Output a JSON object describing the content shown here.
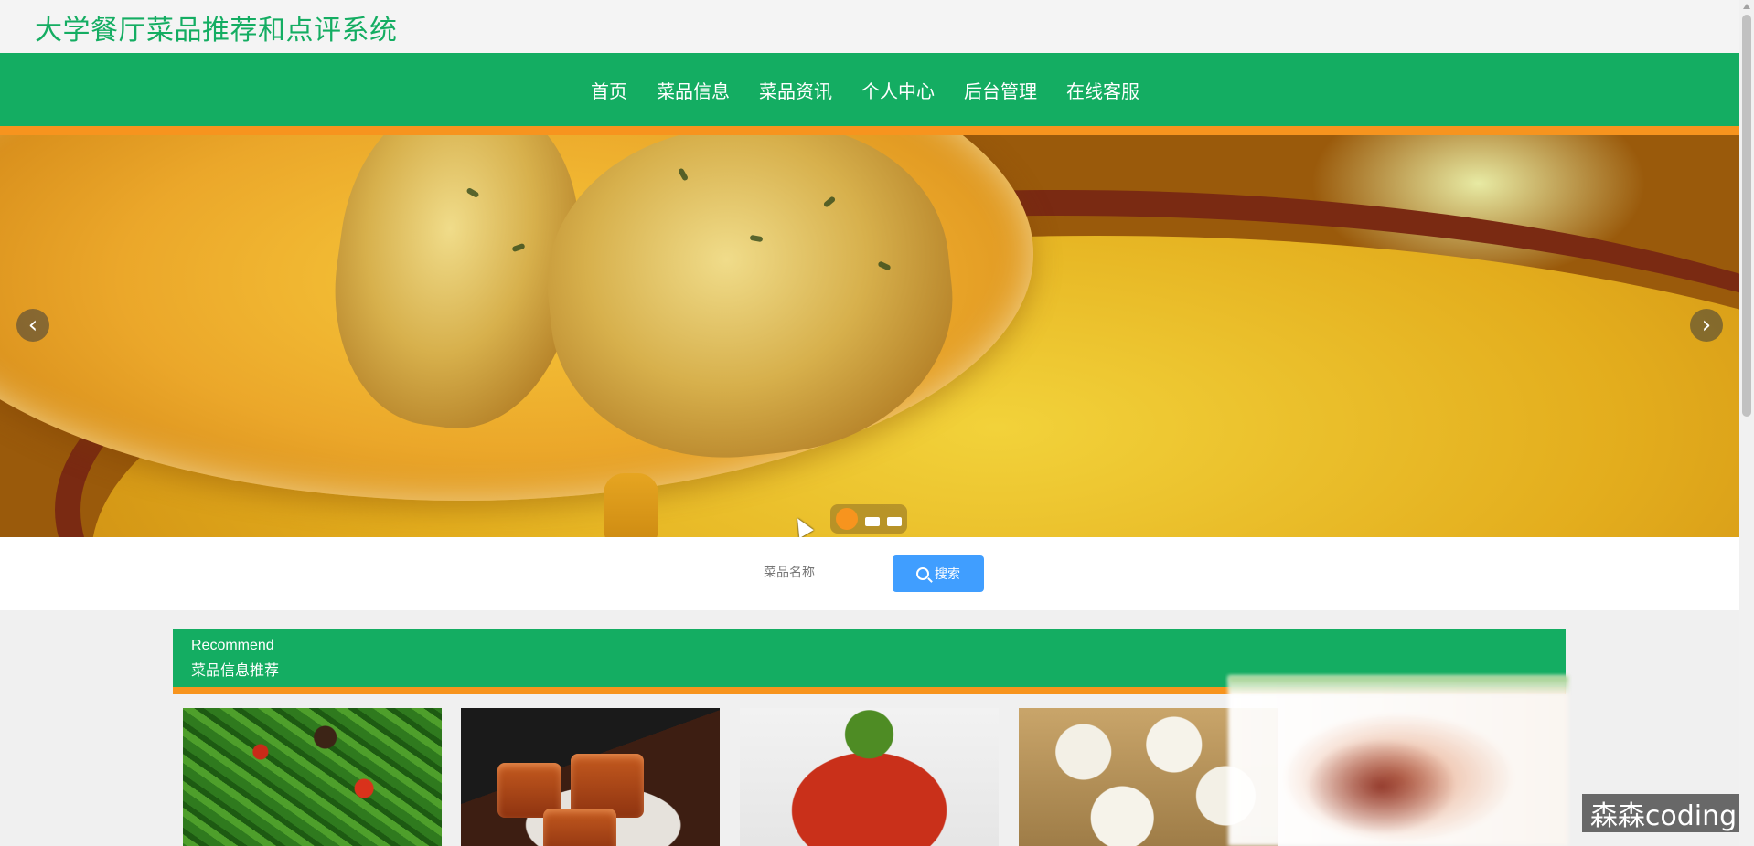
{
  "site": {
    "title": "大学餐厅菜品推荐和点评系统"
  },
  "nav": {
    "items": [
      {
        "label": "首页"
      },
      {
        "label": "菜品信息"
      },
      {
        "label": "菜品资讯"
      },
      {
        "label": "个人中心"
      },
      {
        "label": "后台管理"
      },
      {
        "label": "在线客服"
      }
    ]
  },
  "carousel": {
    "prev_icon": "chevron-left-icon",
    "next_icon": "chevron-right-icon",
    "slide_count": 3,
    "active_index": 1,
    "prev_glyph": "‹",
    "next_glyph": "›"
  },
  "search": {
    "placeholder": "菜品名称",
    "button_label": "搜索",
    "icon": "search-icon"
  },
  "recommend": {
    "title_en": "Recommend",
    "title_cn": "菜品信息推荐"
  },
  "cards": [
    {
      "image": "stir-fried green beans with chili"
    },
    {
      "image": "braised pork belly"
    },
    {
      "image": "spicy dish with coriander"
    },
    {
      "image": "steamed soup dumplings"
    }
  ],
  "watermark": {
    "text": "森森coding"
  },
  "colors": {
    "brand_green": "#14ad62",
    "accent_orange": "#f7941e",
    "button_blue": "#409eff"
  }
}
